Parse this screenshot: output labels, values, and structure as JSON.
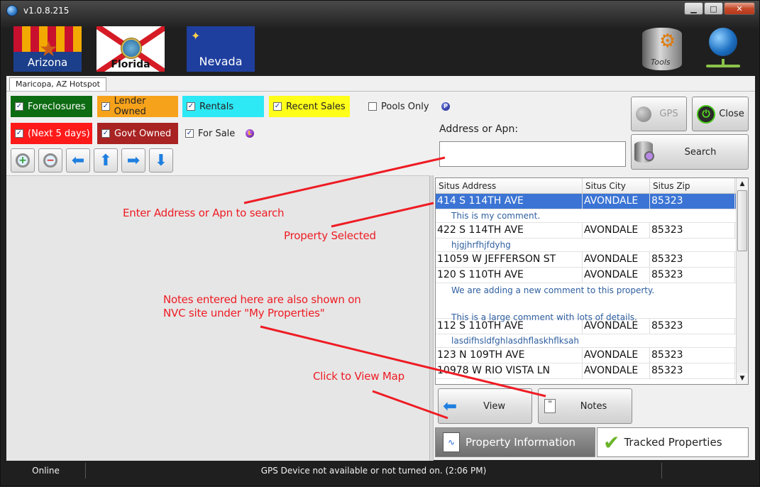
{
  "window": {
    "title": "v1.0.8.215",
    "controls": {
      "minimize": "▁",
      "maximize": "□",
      "close": "✕"
    }
  },
  "header": {
    "flags": [
      {
        "label": "Arizona"
      },
      {
        "label": "Florida"
      },
      {
        "label": "Nevada"
      }
    ],
    "tools_label": "Tools"
  },
  "tabstrip": {
    "active_tab": "Maricopa, AZ Hotspot"
  },
  "filters": {
    "foreclosures": {
      "label": "Foreclosures",
      "checked": true,
      "color": "#0d6b12"
    },
    "lender_owned": {
      "label": "Lender Owned",
      "checked": true,
      "color": "#f7a21b"
    },
    "rentals": {
      "label": "Rentals",
      "checked": true,
      "color": "#2de8f5"
    },
    "recent_sales": {
      "label": "Recent Sales",
      "checked": true,
      "color": "#ffff1a"
    },
    "pools_only": {
      "label": "Pools Only",
      "checked": false
    },
    "next_5_days": {
      "label": "(Next 5 days)",
      "checked": true,
      "color": "#ff1a1a"
    },
    "govt_owned": {
      "label": "Govt Owned",
      "checked": true,
      "color": "#a82322"
    },
    "for_sale": {
      "label": "For Sale",
      "checked": true
    },
    "pools_marker": "P",
    "sale_marker": "L"
  },
  "search": {
    "label": "Address or Apn:",
    "value": "",
    "gps_label": "GPS",
    "close_label": "Close",
    "search_label": "Search"
  },
  "grid": {
    "columns": [
      "Situs Address",
      "Situs City",
      "Situs Zip"
    ],
    "rows": [
      {
        "address": "414 S 114TH AVE",
        "city": "AVONDALE",
        "zip": "85323",
        "note": "This is my comment."
      },
      {
        "address": "422 S 114TH AVE",
        "city": "AVONDALE",
        "zip": "85323",
        "note": "hjgjhrfhjfdyhg"
      },
      {
        "address": "11059 W JEFFERSON ST",
        "city": "AVONDALE",
        "zip": "85323",
        "note": ""
      },
      {
        "address": "120 S 110TH AVE",
        "city": "AVONDALE",
        "zip": "85323",
        "note": "We are adding a new comment to this property.\n\nThis is a large comment with lots of details."
      },
      {
        "address": "112 S 110TH AVE",
        "city": "AVONDALE",
        "zip": "85323",
        "note": "lasdifhsldfghlasdhflaskhflksah"
      },
      {
        "address": "123 N 109TH AVE",
        "city": "AVONDALE",
        "zip": "85323",
        "note": ""
      },
      {
        "address": "10978 W RIO VISTA LN",
        "city": "AVONDALE",
        "zip": "85323",
        "note": ""
      }
    ]
  },
  "actions": {
    "view_label": "View",
    "notes_label": "Notes"
  },
  "bottom_tabs": {
    "property_info": "Property Information",
    "tracked": "Tracked Properties"
  },
  "status": {
    "connection": "Online",
    "message": "GPS Device not available or not turned on. (2:06 PM)"
  },
  "annotations": {
    "enter": "Enter Address or Apn to search",
    "selected": "Property Selected",
    "notes_line1": "Notes entered here are also shown on",
    "notes_line2": "NVC site under \"My Properties\"",
    "view": "Click to View Map"
  }
}
